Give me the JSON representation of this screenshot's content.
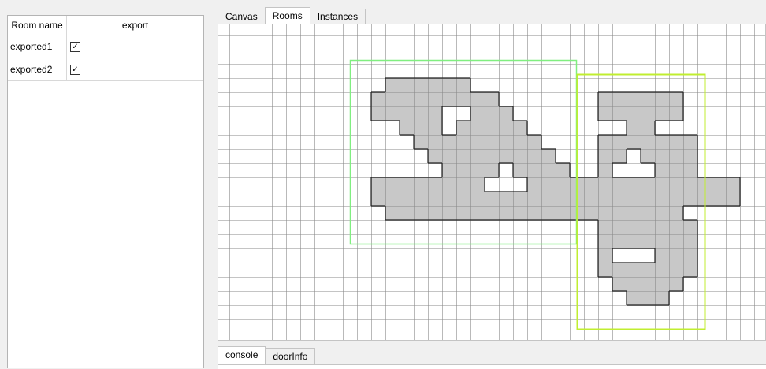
{
  "room_table": {
    "headers": {
      "name": "Room name",
      "export": "export"
    },
    "rows": [
      {
        "name": "exported1",
        "export": true
      },
      {
        "name": "exported2",
        "export": true
      }
    ]
  },
  "top_tabs": [
    "Canvas",
    "Rooms",
    "Instances"
  ],
  "active_top_tab": "Rooms",
  "bottom_tabs": [
    "console",
    "doorInfo"
  ],
  "active_bottom_tab": "console",
  "colors": {
    "room1_outline": "#80ee80",
    "room2_outline": "#c0ee30",
    "room_fill": "#c8c8c8",
    "grid": "#8a8a8a"
  }
}
